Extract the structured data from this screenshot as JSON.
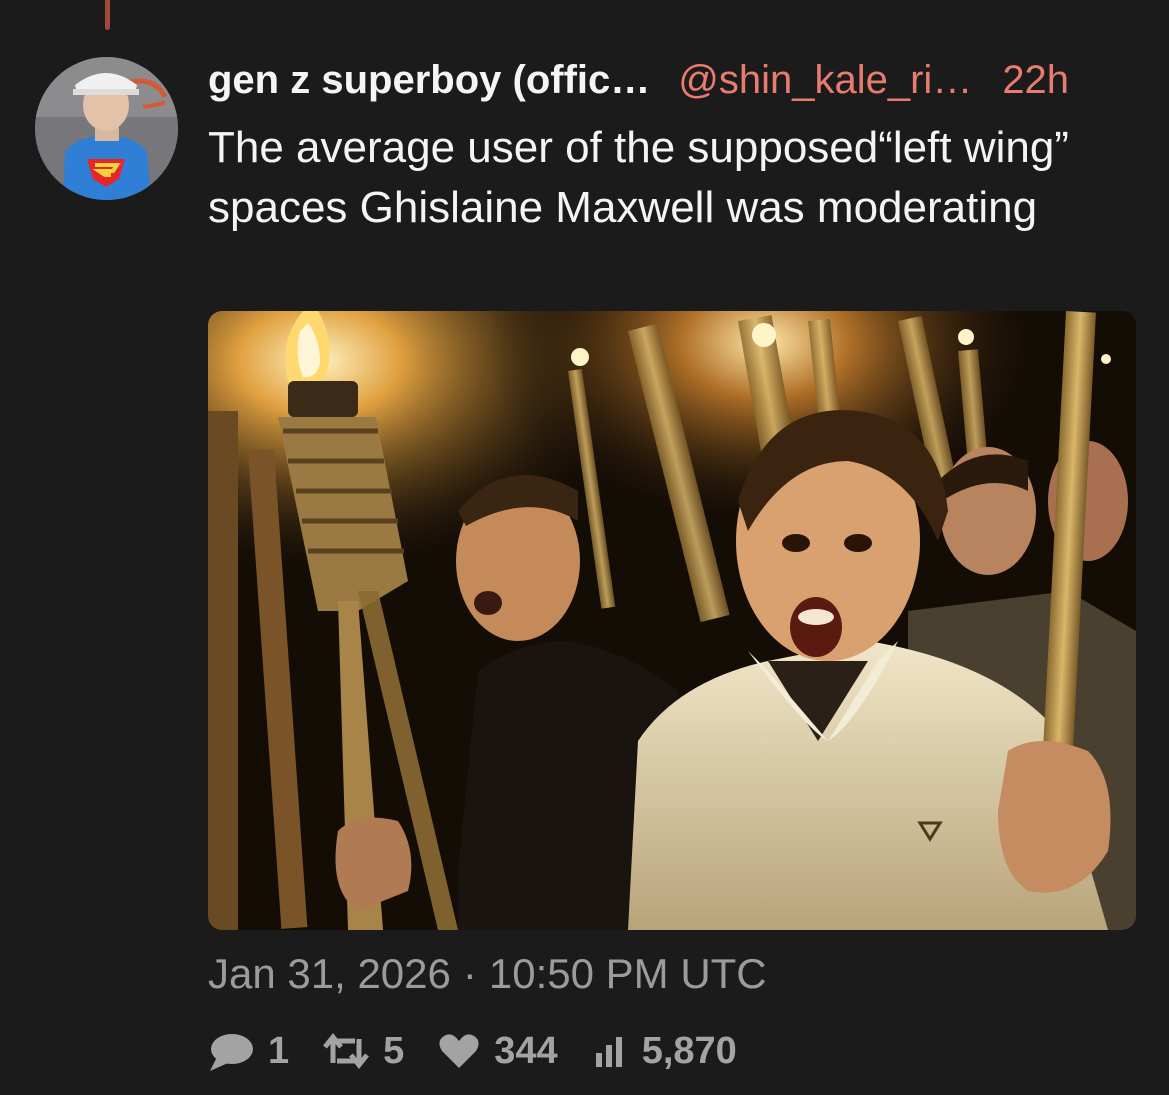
{
  "tweet": {
    "display_name": "gen z superboy (offic…",
    "handle": "@shin_kale_ri…",
    "time_ago": "22h",
    "text": "The average user of the supposed“left wing” spaces Ghislaine Maxwell was moderating",
    "date": "Jan 31, 2026",
    "separator": "·",
    "time": "10:50 PM UTC"
  },
  "stats": {
    "replies": "1",
    "reposts": "5",
    "likes": "344",
    "views": "5,870"
  },
  "icons": {
    "reply": "speech-bubble-icon",
    "repost": "repost-arrows-icon",
    "like": "heart-icon",
    "views": "bar-chart-icon"
  },
  "colors": {
    "background": "#1b1b1c",
    "accent": "#e87c6f",
    "thread_line": "#a4483d",
    "muted": "#9b9b9c"
  }
}
